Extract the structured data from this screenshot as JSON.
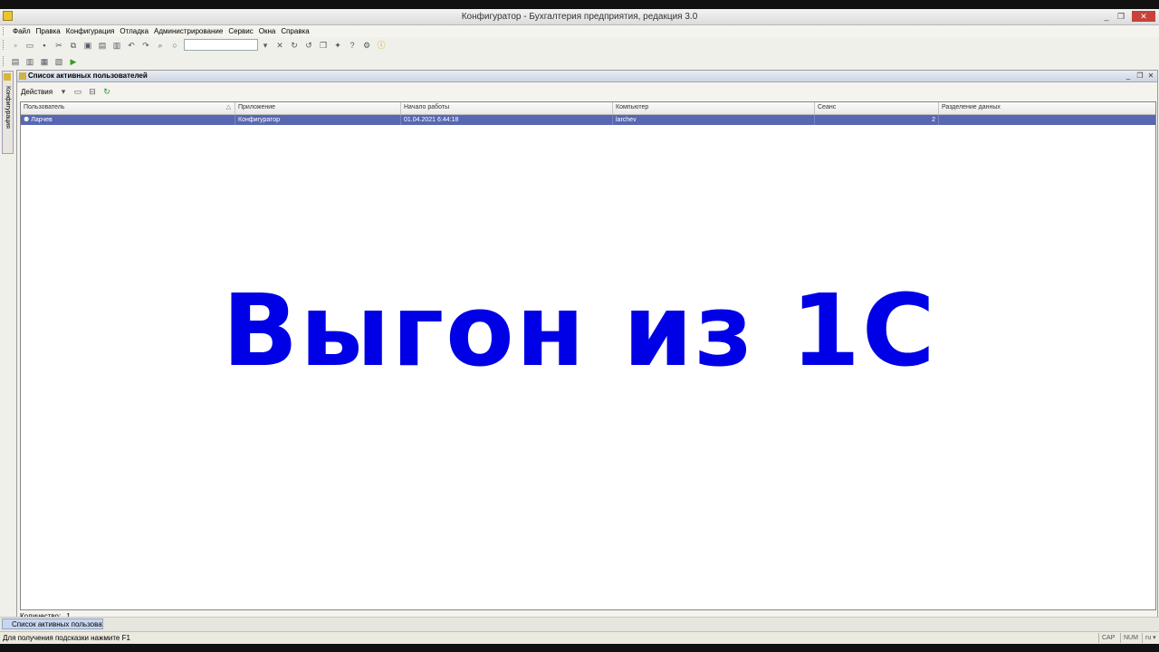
{
  "window": {
    "title": "Конфигуратор - Бухгалтерия предприятия, редакция 3.0",
    "controls": [
      "_",
      "❐",
      "✕"
    ]
  },
  "menu": [
    "Файл",
    "Правка",
    "Конфигурация",
    "Отладка",
    "Администрирование",
    "Сервис",
    "Окна",
    "Справка"
  ],
  "side_tab": {
    "label": "Конфигурация"
  },
  "panel": {
    "title": "Список активных пользователей",
    "actions_label": "Действия"
  },
  "table": {
    "columns": [
      "Пользователь",
      "Приложение",
      "Начало работы",
      "Компьютер",
      "Сеанс",
      "Разделение данных"
    ],
    "rows": [
      {
        "user": "Ларчев",
        "app": "Конфигуратор",
        "start": "01.04.2021 6:44:18",
        "computer": "larchev",
        "session": "2",
        "separation": ""
      }
    ]
  },
  "count": {
    "label": "Количество:",
    "value": "1"
  },
  "taskbar": {
    "item": "Список активных пользоват..."
  },
  "status": {
    "hint": "Для получения подсказки нажмите F1",
    "cap": "CAP",
    "num": "NUM",
    "lang": "ru ▾"
  },
  "overlay_text": "Выгон из 1С",
  "colors": {
    "selection": "#5767b2",
    "overlay": "#0000e6"
  }
}
